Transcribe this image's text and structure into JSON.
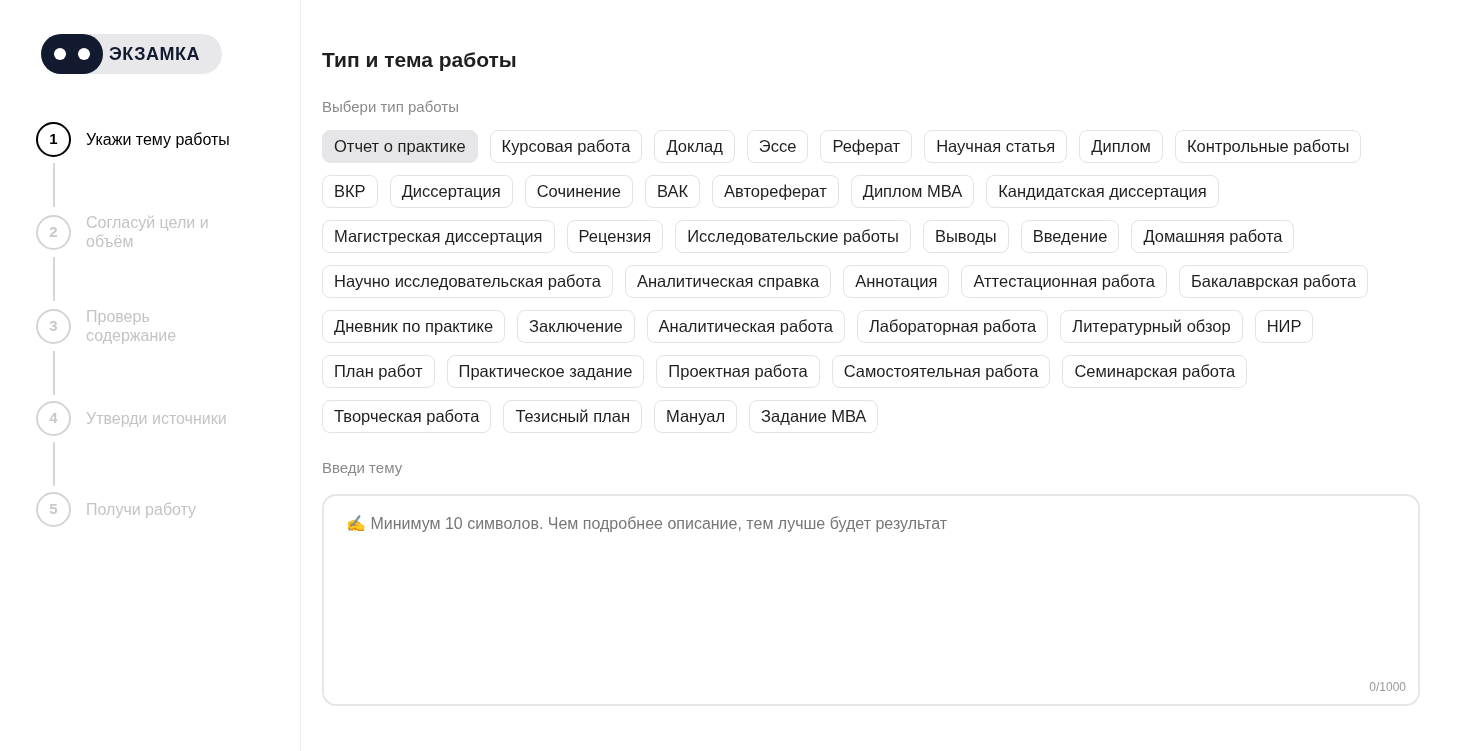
{
  "logo": {
    "text": "ЭКЗАМКА"
  },
  "steps": [
    {
      "number": "1",
      "label": "Укажи тему работы",
      "selected": true
    },
    {
      "number": "2",
      "label": "Согласуй цели и объём",
      "selected": false
    },
    {
      "number": "3",
      "label": "Проверь содержание",
      "selected": false
    },
    {
      "number": "4",
      "label": "Утверди источники",
      "selected": false
    },
    {
      "number": "5",
      "label": "Получи работу",
      "selected": false
    }
  ],
  "title": "Тип и тема работы",
  "type_label": "Выбери тип работы",
  "types": [
    {
      "label": "Отчет о практике",
      "selected": true
    },
    {
      "label": "Курсовая работа",
      "selected": false
    },
    {
      "label": "Доклад",
      "selected": false
    },
    {
      "label": "Эссе",
      "selected": false
    },
    {
      "label": "Реферат",
      "selected": false
    },
    {
      "label": "Научная статья",
      "selected": false
    },
    {
      "label": "Диплом",
      "selected": false
    },
    {
      "label": "Контрольные работы",
      "selected": false
    },
    {
      "label": "ВКР",
      "selected": false
    },
    {
      "label": "Диссертация",
      "selected": false
    },
    {
      "label": "Сочинение",
      "selected": false
    },
    {
      "label": "ВАК",
      "selected": false
    },
    {
      "label": "Автореферат",
      "selected": false
    },
    {
      "label": "Диплом МВА",
      "selected": false
    },
    {
      "label": "Кандидатская диссертация",
      "selected": false
    },
    {
      "label": "Магистреская диссертация",
      "selected": false
    },
    {
      "label": "Рецензия",
      "selected": false
    },
    {
      "label": "Исследовательские работы",
      "selected": false
    },
    {
      "label": "Выводы",
      "selected": false
    },
    {
      "label": "Введение",
      "selected": false
    },
    {
      "label": "Домашняя работа",
      "selected": false
    },
    {
      "label": "Научно исследовательская работа",
      "selected": false
    },
    {
      "label": "Аналитическая справка",
      "selected": false
    },
    {
      "label": "Аннотация",
      "selected": false
    },
    {
      "label": "Аттестационная работа",
      "selected": false
    },
    {
      "label": "Бакалаврская работа",
      "selected": false
    },
    {
      "label": "Дневник по практике",
      "selected": false
    },
    {
      "label": "Заключение",
      "selected": false
    },
    {
      "label": "Аналитическая работа",
      "selected": false
    },
    {
      "label": "Лабораторная работа",
      "selected": false
    },
    {
      "label": "Литературный обзор",
      "selected": false
    },
    {
      "label": "НИР",
      "selected": false
    },
    {
      "label": "План работ",
      "selected": false
    },
    {
      "label": "Практическое задание",
      "selected": false
    },
    {
      "label": "Проектная работа",
      "selected": false
    },
    {
      "label": "Самостоятельная работа",
      "selected": false
    },
    {
      "label": "Семинарская работа",
      "selected": false
    },
    {
      "label": "Творческая работа",
      "selected": false
    },
    {
      "label": "Тезисный план",
      "selected": false
    },
    {
      "label": "Мануал",
      "selected": false
    },
    {
      "label": "Задание МВА",
      "selected": false
    }
  ],
  "topic_label": "Введи тему",
  "topic": {
    "placeholder": "✍ Минимум 10 символов. Чем подробнее описание, тем лучше будет результат",
    "counter": "0/1000"
  }
}
